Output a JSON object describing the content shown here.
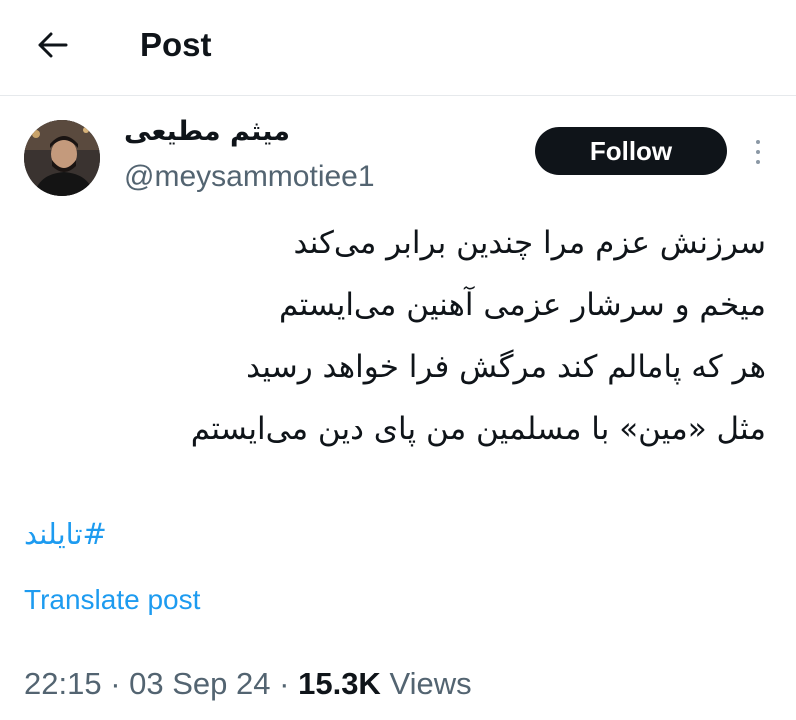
{
  "header": {
    "back_icon": "arrow-left-icon",
    "title": "Post"
  },
  "author": {
    "display_name": "میثم مطیعی",
    "handle": "@meysammotiee1",
    "avatar_icon": "avatar-photo"
  },
  "actions": {
    "follow_label": "Follow",
    "more_icon": "more-vertical-icon"
  },
  "post": {
    "lines": [
      "سرزنش عزم مرا چندین برابر می‌کند",
      "میخم و سرشار عزمی آهنین می‌ایستم",
      "هر که پامالم کند مرگش فرا خواهد رسید",
      "مثل «مین» با مسلمین من پای دین می‌ایستم"
    ],
    "hashtag": "#تایلند",
    "translate_label": "Translate post"
  },
  "meta": {
    "time": "22:15",
    "date": "03 Sep 24",
    "views_count": "15.3K",
    "views_label": "Views",
    "separator": "·"
  },
  "colors": {
    "link": "#1d9bf0",
    "text": "#0f1419",
    "secondary": "#536471",
    "button_bg": "#0f1419"
  }
}
